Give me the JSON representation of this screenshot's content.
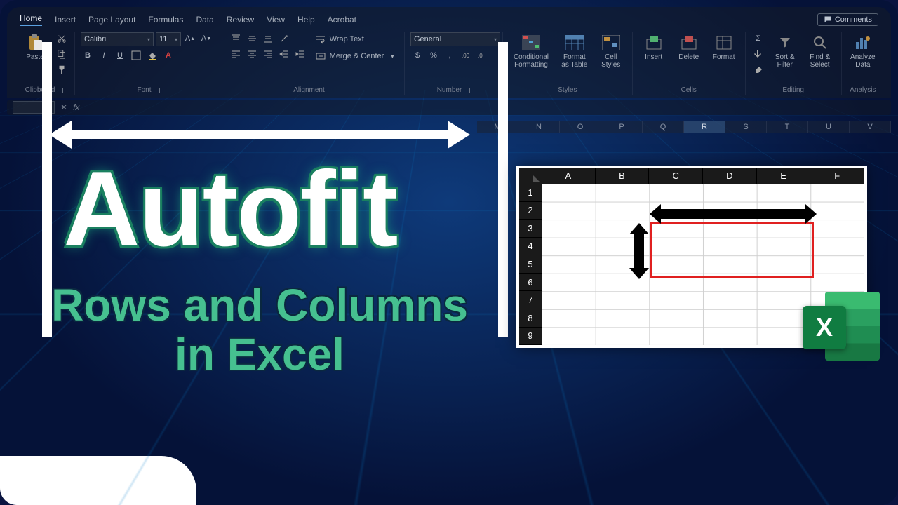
{
  "ribbon": {
    "tabs": [
      "Home",
      "Insert",
      "Page Layout",
      "Formulas",
      "Data",
      "Review",
      "View",
      "Help",
      "Acrobat"
    ],
    "active_tab": "Home",
    "comments": "Comments",
    "clipboard": {
      "label": "Clipboard",
      "paste": "Paste"
    },
    "font": {
      "label": "Font",
      "family": "Calibri",
      "size": "11"
    },
    "alignment": {
      "label": "Alignment",
      "wrap": "Wrap Text",
      "merge": "Merge & Center"
    },
    "number": {
      "label": "Number",
      "format": "General"
    },
    "styles": {
      "label": "Styles",
      "conditional": "Conditional Formatting",
      "table": "Format as Table",
      "cell": "Cell Styles"
    },
    "cells": {
      "label": "Cells",
      "insert": "Insert",
      "delete": "Delete",
      "format": "Format"
    },
    "editing": {
      "label": "Editing",
      "sort": "Sort & Filter",
      "find": "Find & Select"
    },
    "analysis": {
      "label": "Analysis",
      "analyze": "Analyze Data"
    }
  },
  "formula_bar": {
    "fx": "fx"
  },
  "sheet_cols": [
    "M",
    "N",
    "O",
    "P",
    "Q",
    "R",
    "S",
    "T",
    "U",
    "V"
  ],
  "sheet_selected_col": "R",
  "mini_sheet": {
    "cols": [
      "A",
      "B",
      "C",
      "D",
      "E",
      "F"
    ],
    "rows": [
      "1",
      "2",
      "3",
      "4",
      "5",
      "6",
      "7",
      "8",
      "9"
    ]
  },
  "title": {
    "main": "Autofit",
    "sub1": "Rows and Columns",
    "sub2": "in Excel"
  },
  "excel_icon_letter": "X"
}
